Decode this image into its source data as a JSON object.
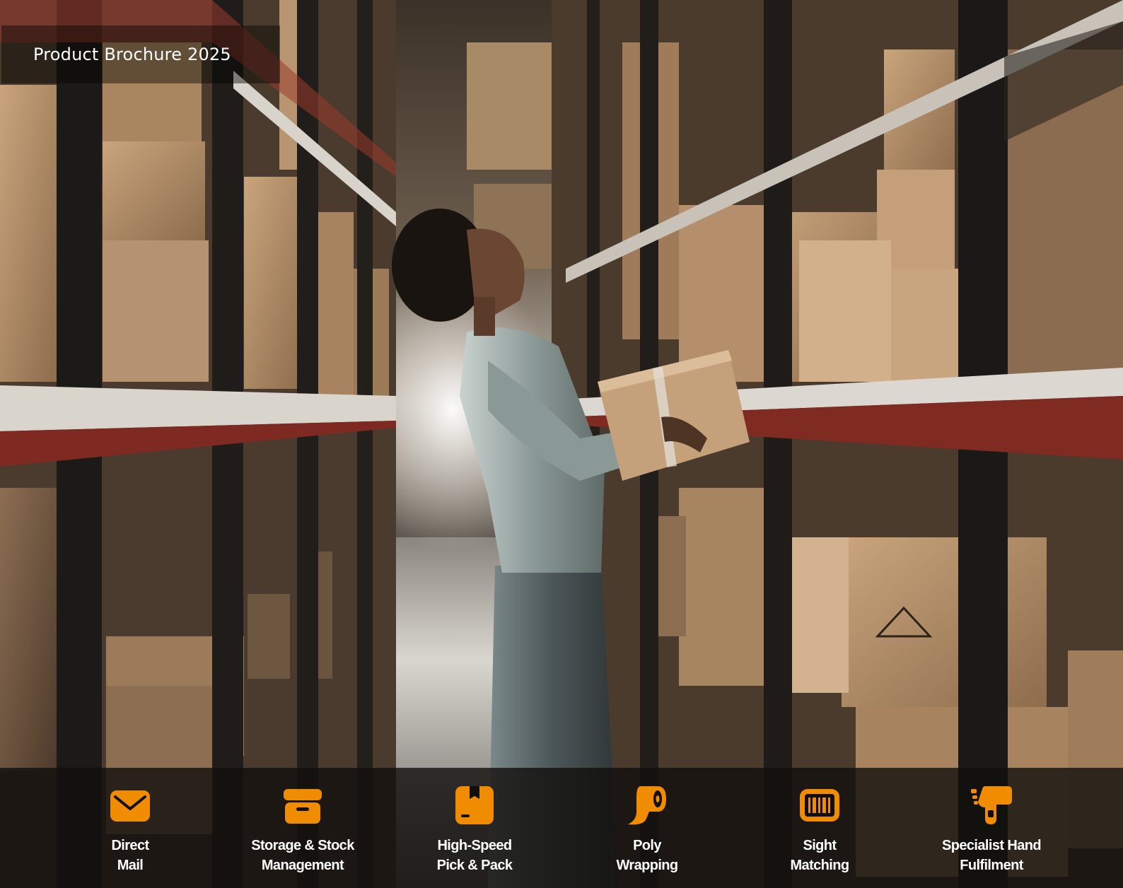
{
  "header": {
    "title": "Product Brochure 2025"
  },
  "colors": {
    "accent": "#f08c00",
    "bar_bg": "#120f0c",
    "text": "#ffffff"
  },
  "services": [
    {
      "icon": "envelope-icon",
      "line1": "Direct",
      "line2": "Mail"
    },
    {
      "icon": "storage-box-icon",
      "line1": "Storage & Stock",
      "line2": "Management"
    },
    {
      "icon": "parcel-box-icon",
      "line1": "High-Speed",
      "line2": "Pick & Pack"
    },
    {
      "icon": "film-roll-icon",
      "line1": "Poly",
      "line2": "Wrapping"
    },
    {
      "icon": "barcode-scanner-icon",
      "line1": "Sight",
      "line2": "Matching"
    },
    {
      "icon": "hand-icon",
      "line1": "Specialist Hand",
      "line2": "Fulfilment"
    }
  ]
}
